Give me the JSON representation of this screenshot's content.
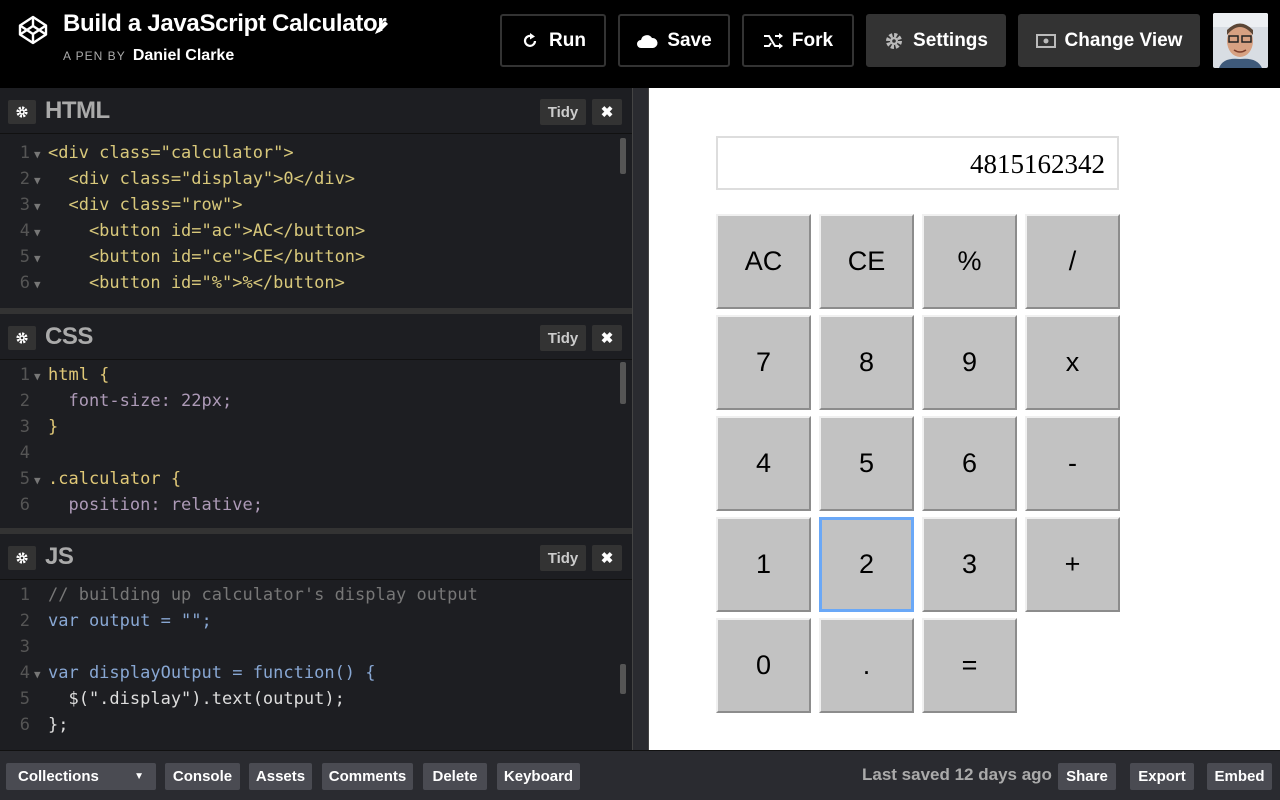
{
  "header": {
    "title": "Build a JavaScript Calculator",
    "byline_prefix": "A PEN BY",
    "author": "Daniel Clarke",
    "buttons": {
      "run": "Run",
      "save": "Save",
      "fork": "Fork",
      "settings": "Settings",
      "change_view": "Change View"
    }
  },
  "panels": {
    "html": {
      "title": "HTML",
      "tidy": "Tidy",
      "close": "✖"
    },
    "css": {
      "title": "CSS",
      "tidy": "Tidy",
      "close": "✖"
    },
    "js": {
      "title": "JS",
      "tidy": "Tidy",
      "close": "✖"
    }
  },
  "code": {
    "html": [
      {
        "n": "1",
        "text": "<div class=\"calculator\">"
      },
      {
        "n": "2",
        "text": "  <div class=\"display\">0</div>"
      },
      {
        "n": "3",
        "text": "  <div class=\"row\">"
      },
      {
        "n": "4",
        "text": "    <button id=\"ac\">AC</button>"
      },
      {
        "n": "5",
        "text": "    <button id=\"ce\">CE</button>"
      },
      {
        "n": "6",
        "text": "    <button id=\"%\">%</button>"
      }
    ],
    "css": [
      {
        "n": "1",
        "text": "html {"
      },
      {
        "n": "2",
        "text": "  font-size: 22px;"
      },
      {
        "n": "3",
        "text": "}"
      },
      {
        "n": "4",
        "text": ""
      },
      {
        "n": "5",
        "text": ".calculator {"
      },
      {
        "n": "6",
        "text": "  position: relative;"
      }
    ],
    "js": [
      {
        "n": "1",
        "text": "// building up calculator's display output"
      },
      {
        "n": "2",
        "text": "var output = \"\";"
      },
      {
        "n": "3",
        "text": ""
      },
      {
        "n": "4",
        "text": "var displayOutput = function() {"
      },
      {
        "n": "5",
        "text": "  $(\".display\").text(output);"
      },
      {
        "n": "6",
        "text": "};"
      }
    ]
  },
  "calculator": {
    "display": "4815162342",
    "keys": [
      "AC",
      "CE",
      "%",
      "/",
      "7",
      "8",
      "9",
      "x",
      "4",
      "5",
      "6",
      "-",
      "1",
      "2",
      "3",
      "+",
      "0",
      ".",
      "="
    ],
    "focused_key": "2"
  },
  "footer": {
    "collections": "Collections",
    "console": "Console",
    "assets": "Assets",
    "comments": "Comments",
    "delete": "Delete",
    "keyboard": "Keyboard",
    "last_saved": "Last saved 12 days ago",
    "share": "Share",
    "export": "Export",
    "embed": "Embed"
  }
}
